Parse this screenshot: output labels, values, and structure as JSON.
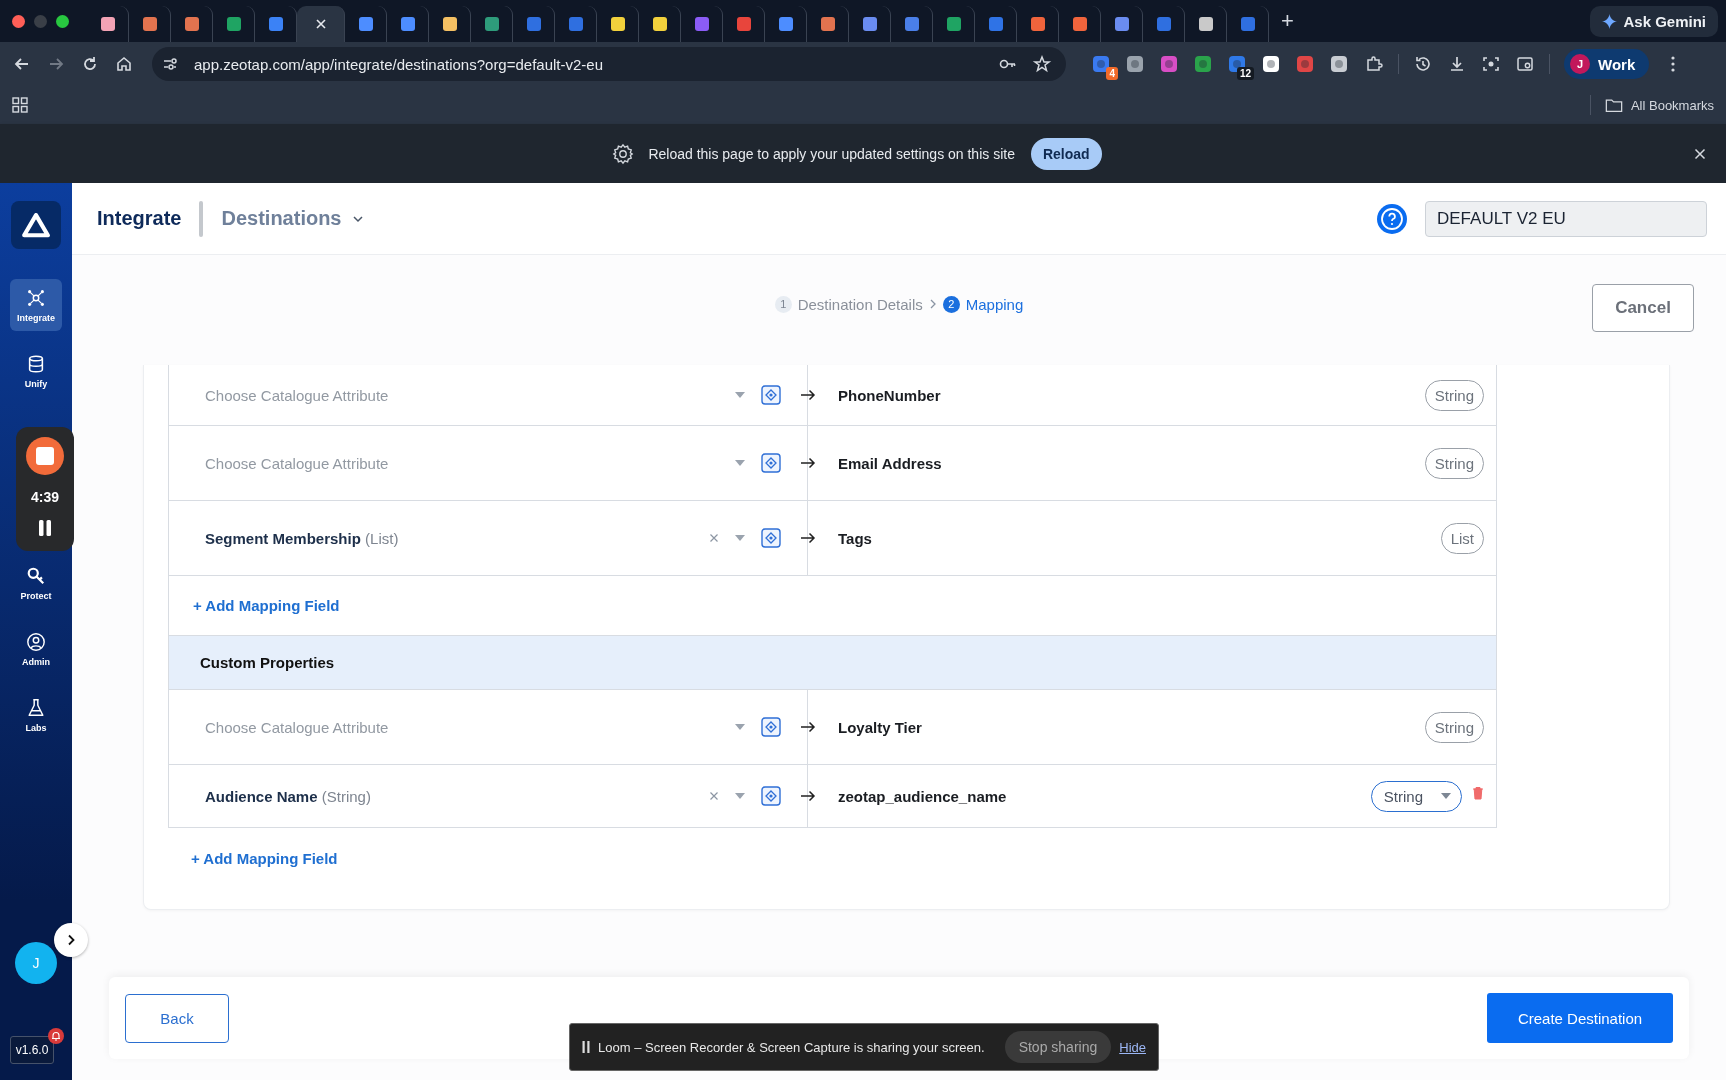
{
  "browser": {
    "tabs": [
      {
        "selected": false
      },
      {
        "selected": false
      },
      {
        "selected": false
      },
      {
        "selected": false
      },
      {
        "selected": false
      },
      {
        "selected": true
      },
      {
        "selected": false
      },
      {
        "selected": false
      },
      {
        "selected": false
      },
      {
        "selected": false
      },
      {
        "selected": false
      },
      {
        "selected": false
      },
      {
        "selected": false
      },
      {
        "selected": false
      },
      {
        "selected": false
      },
      {
        "selected": false
      },
      {
        "selected": false
      },
      {
        "selected": false
      },
      {
        "selected": false
      },
      {
        "selected": false
      },
      {
        "selected": false
      },
      {
        "selected": false
      },
      {
        "selected": false
      },
      {
        "selected": false
      },
      {
        "selected": false
      },
      {
        "selected": false
      },
      {
        "selected": false
      },
      {
        "selected": false
      }
    ],
    "new_tab": "+",
    "gemini_button": "Ask Gemini",
    "url": "app.zeotap.com/app/integrate/destinations?org=default-v2-eu",
    "extensions": [
      {
        "kind": "badged",
        "badge": "4"
      },
      {
        "kind": "plain"
      },
      {
        "kind": "plain"
      },
      {
        "kind": "plain"
      },
      {
        "kind": "badged",
        "badge": "12"
      },
      {
        "kind": "plain"
      },
      {
        "kind": "plain"
      },
      {
        "kind": "plain"
      }
    ],
    "profile": {
      "initial": "J",
      "label": "Work"
    },
    "all_bookmarks": "All Bookmarks"
  },
  "infobar": {
    "message": "Reload this page to apply your updated settings on this site",
    "button": "Reload"
  },
  "sidebar": {
    "items": [
      {
        "label": "Integrate",
        "selected": true
      },
      {
        "label": "Unify",
        "selected": false
      },
      {
        "label": "Protect",
        "selected": false
      },
      {
        "label": "Admin",
        "selected": false
      },
      {
        "label": "Labs",
        "selected": false
      }
    ],
    "avatar": "J",
    "version": "v1.6.0"
  },
  "recorder": {
    "time": "4:39"
  },
  "header": {
    "title": "Integrate",
    "section": "Destinations",
    "org": "DEFAULT V2 EU"
  },
  "stepper": {
    "steps": [
      {
        "number": "1",
        "label": "Destination Details",
        "selected": false
      },
      {
        "number": "2",
        "label": "Mapping",
        "selected": true
      }
    ]
  },
  "cancel": "Cancel",
  "mapping": {
    "lines": [
      {
        "kind": "mapping",
        "source": {
          "placeholder": "Choose Catalogue Attribute"
        },
        "target": {
          "name": "PhoneNumber",
          "type": "String",
          "editable": false
        }
      },
      {
        "kind": "mapping",
        "source": {
          "placeholder": "Choose Catalogue Attribute"
        },
        "target": {
          "name": "Email Address",
          "type": "String",
          "editable": false
        }
      },
      {
        "kind": "mapping",
        "source": {
          "value": "Segment Membership",
          "type": "(List)"
        },
        "target": {
          "name": "Tags",
          "type": "List",
          "editable": false
        }
      },
      {
        "kind": "add",
        "label": "+ Add Mapping Field"
      },
      {
        "kind": "section",
        "title": "Custom Properties"
      },
      {
        "kind": "mapping",
        "source": {
          "placeholder": "Choose Catalogue Attribute"
        },
        "target": {
          "name": "Loyalty Tier",
          "type": "String",
          "editable": false
        }
      },
      {
        "kind": "mapping",
        "source": {
          "value": "Audience Name",
          "type": "(String)"
        },
        "target": {
          "name": "zeotap_audience_name",
          "type": "String",
          "editable": true
        }
      }
    ],
    "add_link": "+ Add Mapping Field"
  },
  "footer": {
    "back": "Back",
    "create": "Create Destination"
  },
  "loom": {
    "message": "Loom – Screen Recorder & Screen Capture is sharing your screen.",
    "stop": "Stop sharing",
    "hide": "Hide"
  }
}
